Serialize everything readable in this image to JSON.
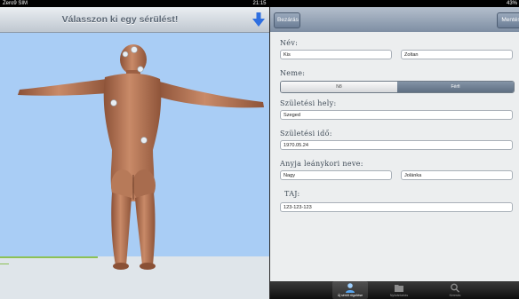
{
  "status_bar": {
    "carrier": "Zero9 SIM",
    "time": "21:15",
    "battery": "43%"
  },
  "left": {
    "title": "Válasszon ki egy sérülést!",
    "arrow_icon": "arrow-down-icon"
  },
  "toolbar": {
    "close_label": "Bezárás",
    "right_label": "Mentés"
  },
  "form": {
    "name_label": "Név:",
    "last_name": "Kis",
    "first_name": "Zoltan",
    "gender_label": "Neme:",
    "gender_options": [
      "Nő",
      "Férfi"
    ],
    "gender_selected": "Férfi",
    "birthplace_label": "Születési hely:",
    "birthplace": "Szeged",
    "birthdate_label": "Születési idő:",
    "birthdate": "1970.05.24",
    "mother_label": "Anyja leánykori neve:",
    "mother_last": "Nagy",
    "mother_first": "Jolánka",
    "taj_label": "TAJ:",
    "taj": "123-123-123"
  },
  "tabbar": {
    "tabs": [
      {
        "label": "Új sérült rögzítése",
        "icon": "person-icon",
        "active": true
      },
      {
        "label": "Nyilvántartás",
        "icon": "folder-icon",
        "active": false
      },
      {
        "label": "Keresés",
        "icon": "search-icon",
        "active": false
      }
    ]
  },
  "colors": {
    "viewport_bg": "#a9cdf5",
    "toolbar": "#8d9cb0",
    "skin": "#b97a5c",
    "marker": "#e8eef3"
  }
}
